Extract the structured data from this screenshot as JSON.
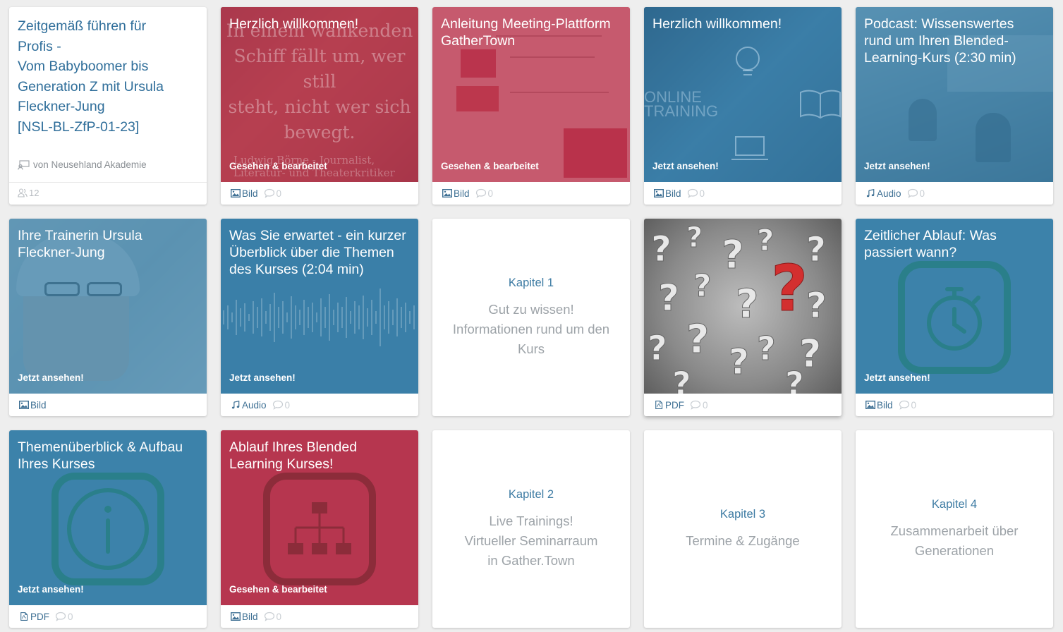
{
  "course": {
    "title": "Zeitgemäß führen für\nProfis -\nVom Babyboomer bis\nGeneration Z mit Ursula\nFleckner-Jung\n[NSL-BL-ZfP-01-23]",
    "author": "von Neusehland Akademie",
    "members": "12"
  },
  "cards": {
    "c1": {
      "title": "Herzlich willkommen!",
      "status": "Gesehen & bearbeitet",
      "type": "Bild",
      "comments": "0",
      "bg_text": "In einem wankenden\nSchiff fällt um, wer still\nsteht, nicht wer sich\nbewegt.",
      "bg_quote": "Ludwig Börne - Journalist,\nLiteratur- und Theaterkritiker"
    },
    "c2": {
      "title": "Anleitung Meeting-Plattform\nGatherTown",
      "status": "Gesehen & bearbeitet",
      "type": "Bild",
      "comments": "0"
    },
    "c3": {
      "title": "Herzlich willkommen!",
      "status": "Jetzt ansehen!",
      "type": "Bild",
      "comments": "0",
      "bg_text": "ONLINE\nTRAINING"
    },
    "c4": {
      "title": "Podcast: Wissenswertes\nrund um Ihren Blended-\nLearning-Kurs (2:30 min)",
      "status": "Jetzt ansehen!",
      "type": "Audio",
      "comments": "0"
    },
    "c5": {
      "title": "Ihre Trainerin Ursula\nFleckner-Jung",
      "status": "Jetzt ansehen!",
      "type": "Bild"
    },
    "c6": {
      "title": "Was Sie erwartet - ein kurzer\nÜberblick über die Themen\ndes Kurses (2:04 min)",
      "status": "Jetzt ansehen!",
      "type": "Audio",
      "comments": "0"
    },
    "c7": {
      "label": "Kapitel 1",
      "title": "Gut zu wissen!\nInformationen rund um den\nKurs"
    },
    "c8": {
      "type": "PDF",
      "comments": "0"
    },
    "c9": {
      "title": "Zeitlicher Ablauf: Was\npassiert wann?",
      "status": "Jetzt ansehen!",
      "type": "Bild",
      "comments": "0"
    },
    "c10": {
      "title": "Themenüberblick & Aufbau\nIhres Kurses",
      "status": "Jetzt ansehen!",
      "type": "PDF",
      "comments": "0"
    },
    "c11": {
      "title": "Ablauf Ihres Blended\nLearning Kurses!",
      "status": "Gesehen & bearbeitet",
      "type": "Bild",
      "comments": "0"
    },
    "c12": {
      "label": "Kapitel 2",
      "title": "Live Trainings!\nVirtueller Seminarraum\nin Gather.Town"
    },
    "c13": {
      "label": "Kapitel 3",
      "title": "Termine & Zugänge"
    },
    "c14": {
      "label": "Kapitel 4",
      "title": "Zusammenarbeit über\nGenerationen"
    }
  },
  "icons": {
    "image": "image-icon",
    "audio": "music-note-icon",
    "pdf": "pdf-file-icon",
    "comment": "comment-bubble-icon",
    "author": "author-board-icon",
    "members": "members-icon",
    "stopwatch": "stopwatch-icon",
    "info": "info-icon",
    "hierarchy": "hierarchy-icon",
    "questions": "question-marks-icon"
  },
  "colors": {
    "red_overlay": "#ba344e",
    "blue_overlay": "#3c82aa",
    "link_blue": "#2f6e9a",
    "grey_text": "#9da3a8"
  }
}
